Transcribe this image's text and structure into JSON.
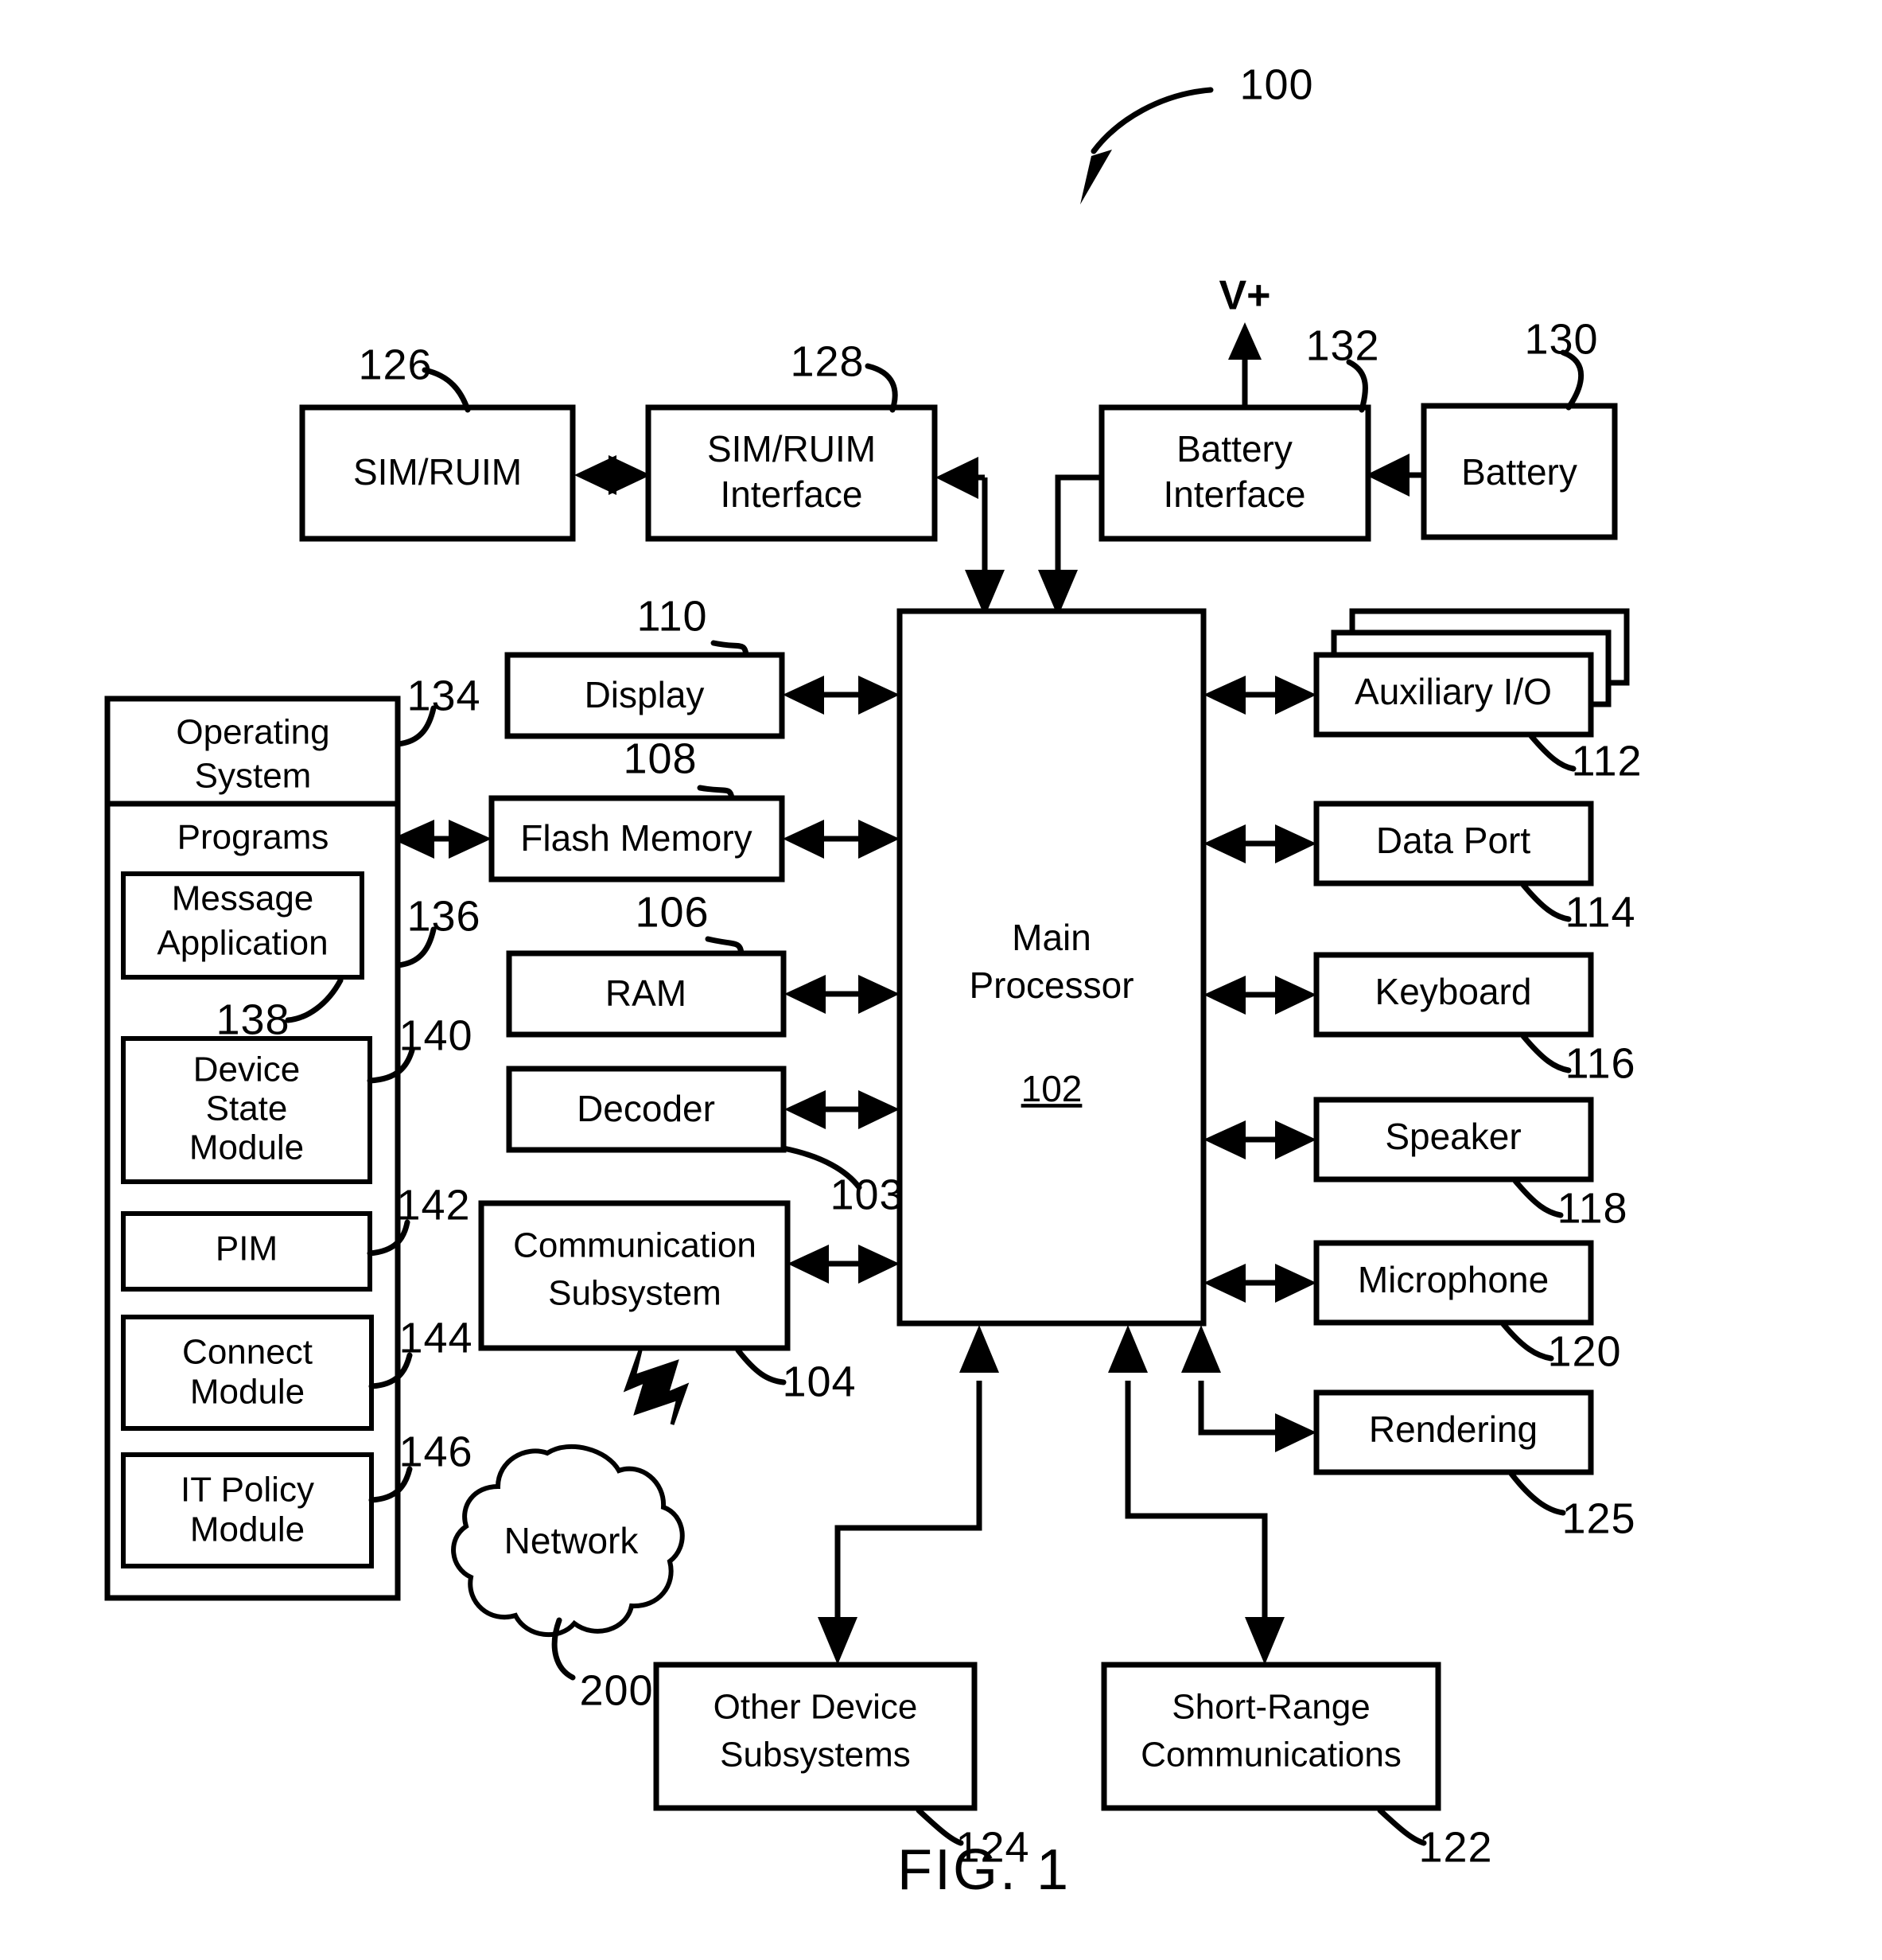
{
  "figure": {
    "caption": "FIG. 1",
    "top_ref": "100",
    "power_label": "V+"
  },
  "blocks": {
    "sim_ruim": {
      "label": "SIM/RUIM",
      "ref": "126"
    },
    "sim_ruim_iface": {
      "label_line1": "SIM/RUIM",
      "label_line2": "Interface",
      "ref": "128"
    },
    "battery_iface": {
      "label_line1": "Battery",
      "label_line2": "Interface",
      "ref": "132"
    },
    "battery": {
      "label": "Battery",
      "ref": "130"
    },
    "display": {
      "label": "Display",
      "ref": "110"
    },
    "flash_memory": {
      "label": "Flash Memory",
      "ref": "108"
    },
    "ram": {
      "label": "RAM",
      "ref": "106"
    },
    "decoder": {
      "label": "Decoder",
      "ref": "103"
    },
    "comm_subsystem": {
      "label_line1": "Communication",
      "label_line2": "Subsystem",
      "ref": "104"
    },
    "network": {
      "label": "Network",
      "ref": "200"
    },
    "main_processor": {
      "label_line1": "Main",
      "label_line2": "Processor",
      "ref": "102"
    },
    "aux_io": {
      "label": "Auxiliary I/O",
      "ref": "112"
    },
    "data_port": {
      "label": "Data Port",
      "ref": "114"
    },
    "keyboard": {
      "label": "Keyboard",
      "ref": "116"
    },
    "speaker": {
      "label": "Speaker",
      "ref": "118"
    },
    "microphone": {
      "label": "Microphone",
      "ref": "120"
    },
    "rendering": {
      "label": "Rendering",
      "ref": "125"
    },
    "other_subsystems": {
      "label_line1": "Other Device",
      "label_line2": "Subsystems",
      "ref": "124"
    },
    "short_range": {
      "label_line1": "Short-Range",
      "label_line2": "Communications",
      "ref": "122"
    }
  },
  "memory_panel": {
    "operating_system": {
      "label_line1": "Operating",
      "label_line2": "System",
      "ref": "134"
    },
    "programs": {
      "label": "Programs",
      "ref": "136"
    },
    "message_app": {
      "label_line1": "Message",
      "label_line2": "Application",
      "ref": "138"
    },
    "device_state": {
      "label_line1": "Device",
      "label_line2": "State",
      "label_line3": "Module",
      "ref": "140"
    },
    "pim": {
      "label": "PIM",
      "ref": "142"
    },
    "connect_module": {
      "label_line1": "Connect",
      "label_line2": "Module",
      "ref": "144"
    },
    "it_policy_module": {
      "label_line1": "IT Policy",
      "label_line2": "Module",
      "ref": "146"
    }
  },
  "colors": {
    "ink": "#000000",
    "paper": "#ffffff"
  }
}
